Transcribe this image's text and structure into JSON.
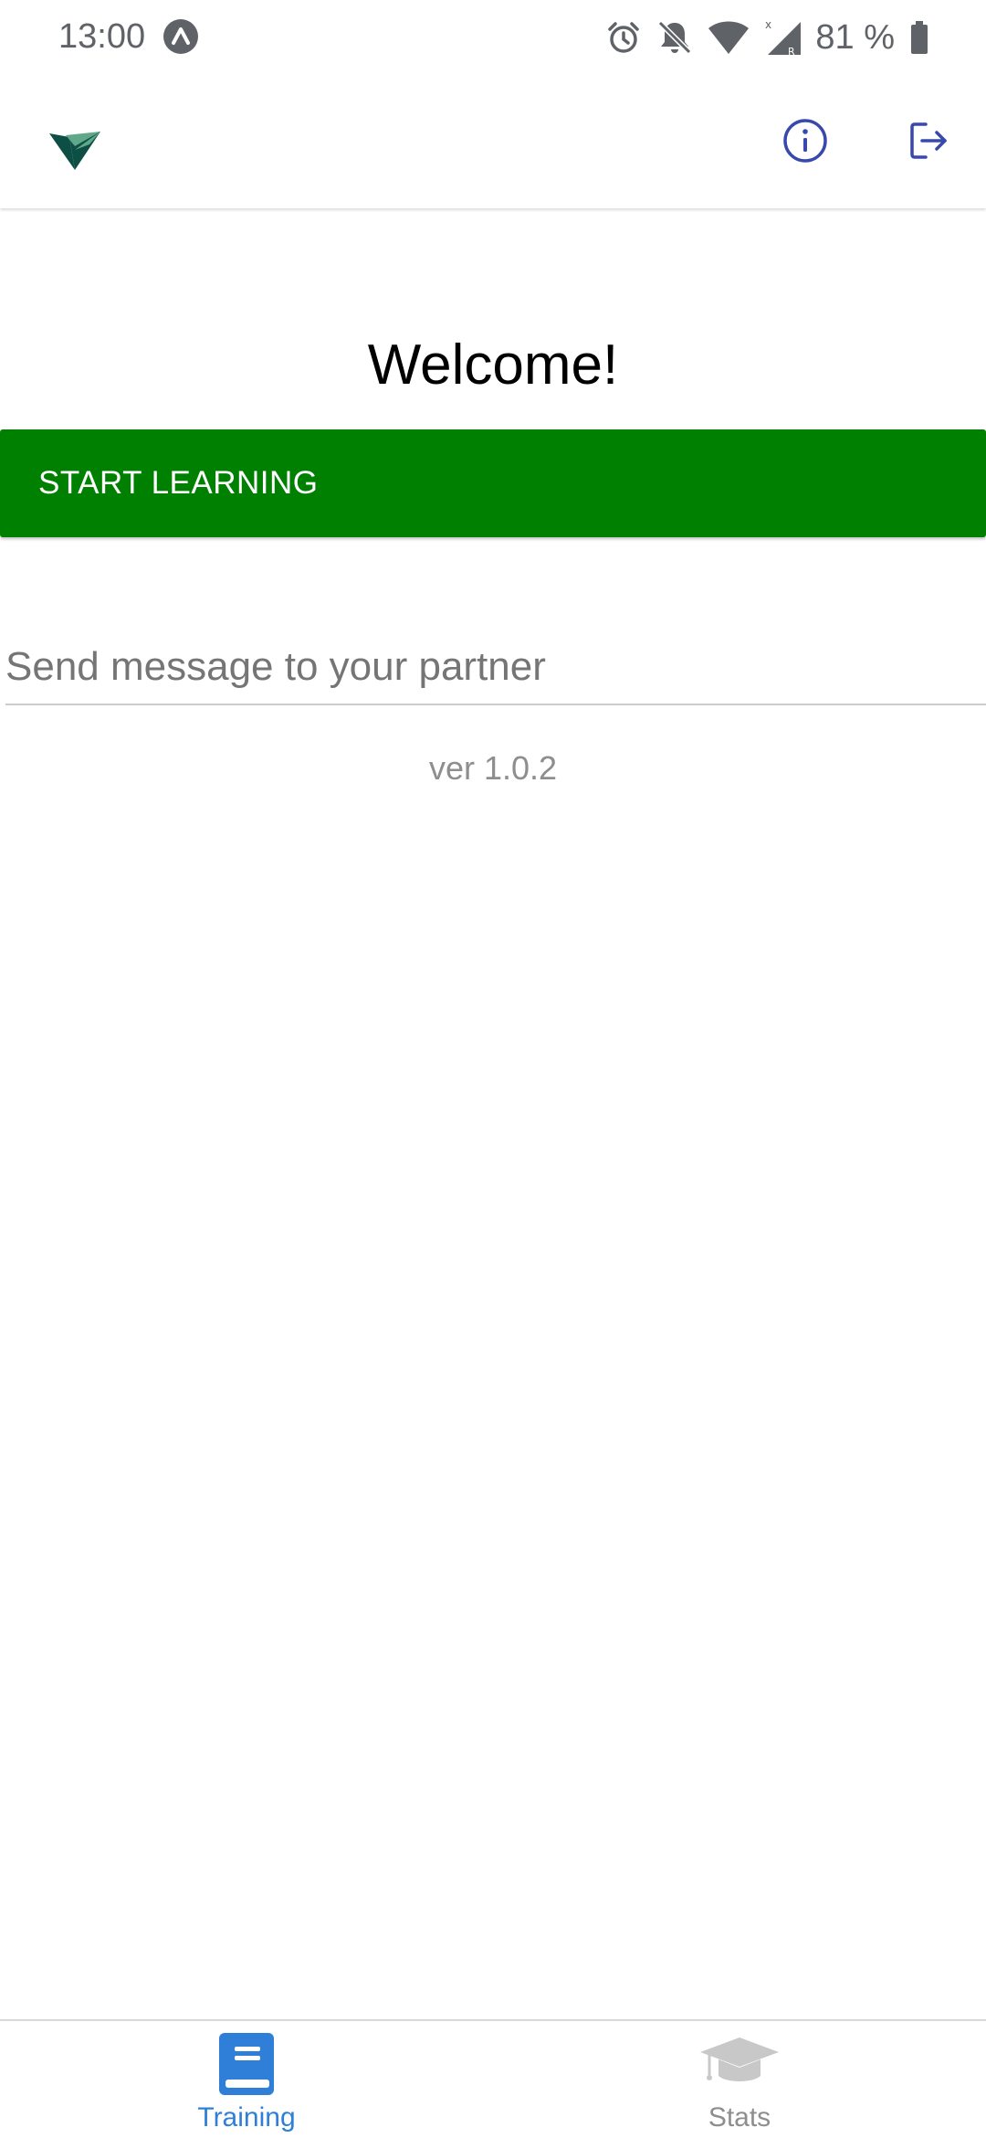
{
  "status_bar": {
    "time": "13:00",
    "battery": "81 %",
    "icons": [
      "app-notification-icon",
      "alarm-icon",
      "bell-off-icon",
      "wifi-icon",
      "signal-icon",
      "battery-icon"
    ]
  },
  "app_bar": {
    "logo": "app-logo",
    "actions": [
      "info-icon",
      "logout-icon"
    ]
  },
  "main": {
    "welcome": "Welcome!",
    "start_button": "START LEARNING",
    "message_placeholder": "Send message to your partner",
    "version": "ver 1.0.2"
  },
  "tabs": [
    {
      "label": "Training",
      "icon": "book-icon",
      "active": true
    },
    {
      "label": "Stats",
      "icon": "graduation-cap-icon",
      "active": false
    }
  ],
  "colors": {
    "primary_button": "#008000",
    "active_tab": "#2f7fd8",
    "inactive_tab": "#8e8e8e",
    "icon_accent": "#3949ab",
    "logo_dark": "#0e4f45",
    "logo_light": "#5fa88a"
  }
}
